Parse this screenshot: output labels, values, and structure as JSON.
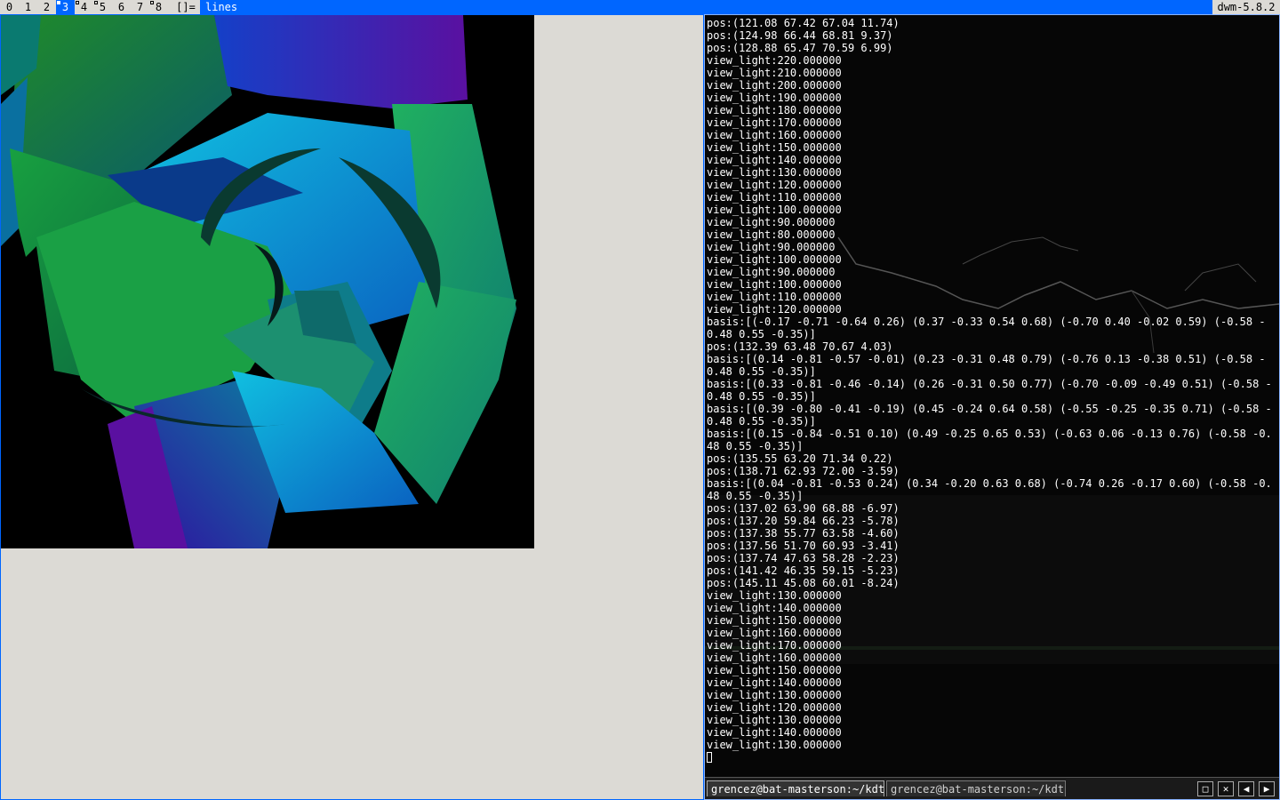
{
  "bar": {
    "tags": [
      {
        "label": "0",
        "selected": false,
        "occupied": false
      },
      {
        "label": "1",
        "selected": false,
        "occupied": false
      },
      {
        "label": "2",
        "selected": false,
        "occupied": false
      },
      {
        "label": "3",
        "selected": true,
        "occupied": true
      },
      {
        "label": "4",
        "selected": false,
        "occupied": true
      },
      {
        "label": "5",
        "selected": false,
        "occupied": true
      },
      {
        "label": "6",
        "selected": false,
        "occupied": false
      },
      {
        "label": "7",
        "selected": false,
        "occupied": false
      },
      {
        "label": "8",
        "selected": false,
        "occupied": true
      }
    ],
    "layout_symbol": "[]=",
    "window_title": "lines",
    "status": "dwm-5.8.2",
    "accent_color": "#0066ff"
  },
  "gl_window": {
    "name": "lines"
  },
  "terminal": {
    "lines": [
      "pos:(121.08 67.42 67.04 11.74)",
      "pos:(124.98 66.44 68.81 9.37)",
      "pos:(128.88 65.47 70.59 6.99)",
      "view_light:220.000000",
      "view_light:210.000000",
      "view_light:200.000000",
      "view_light:190.000000",
      "view_light:180.000000",
      "view_light:170.000000",
      "view_light:160.000000",
      "view_light:150.000000",
      "view_light:140.000000",
      "view_light:130.000000",
      "view_light:120.000000",
      "view_light:110.000000",
      "view_light:100.000000",
      "view_light:90.000000",
      "view_light:80.000000",
      "view_light:90.000000",
      "view_light:100.000000",
      "view_light:90.000000",
      "view_light:100.000000",
      "view_light:110.000000",
      "view_light:120.000000",
      "basis:[(-0.17 -0.71 -0.64 0.26) (0.37 -0.33 0.54 0.68) (-0.70 0.40 -0.02 0.59) (-0.58 -0.48 0.55 -0.35)]",
      "pos:(132.39 63.48 70.67 4.03)",
      "basis:[(0.14 -0.81 -0.57 -0.01) (0.23 -0.31 0.48 0.79) (-0.76 0.13 -0.38 0.51) (-0.58 -0.48 0.55 -0.35)]",
      "basis:[(0.33 -0.81 -0.46 -0.14) (0.26 -0.31 0.50 0.77) (-0.70 -0.09 -0.49 0.51) (-0.58 -0.48 0.55 -0.35)]",
      "basis:[(0.39 -0.80 -0.41 -0.19) (0.45 -0.24 0.64 0.58) (-0.55 -0.25 -0.35 0.71) (-0.58 -0.48 0.55 -0.35)]",
      "basis:[(0.15 -0.84 -0.51 0.10) (0.49 -0.25 0.65 0.53) (-0.63 0.06 -0.13 0.76) (-0.58 -0.48 0.55 -0.35)]",
      "pos:(135.55 63.20 71.34 0.22)",
      "pos:(138.71 62.93 72.00 -3.59)",
      "basis:[(0.04 -0.81 -0.53 0.24) (0.34 -0.20 0.63 0.68) (-0.74 0.26 -0.17 0.60) (-0.58 -0.48 0.55 -0.35)]",
      "pos:(137.02 63.90 68.88 -6.97)",
      "pos:(137.20 59.84 66.23 -5.78)",
      "pos:(137.38 55.77 63.58 -4.60)",
      "pos:(137.56 51.70 60.93 -3.41)",
      "pos:(137.74 47.63 58.28 -2.23)",
      "pos:(141.42 46.35 59.15 -5.23)",
      "pos:(145.11 45.08 60.01 -8.24)",
      "view_light:130.000000",
      "view_light:140.000000",
      "view_light:150.000000",
      "view_light:160.000000",
      "view_light:170.000000",
      "view_light:160.000000",
      "view_light:150.000000",
      "view_light:140.000000",
      "view_light:130.000000",
      "view_light:120.000000",
      "view_light:130.000000",
      "view_light:140.000000",
      "view_light:130.000000"
    ],
    "tabs": [
      {
        "label": "grencez@bat-masterson:~/kdt",
        "active": true
      },
      {
        "label": "grencez@bat-masterson:~/kdt",
        "active": false
      }
    ],
    "buttons": [
      {
        "name": "new-tab-icon",
        "glyph": "□"
      },
      {
        "name": "close-tab-icon",
        "glyph": "✕"
      },
      {
        "name": "prev-tab-icon",
        "glyph": "◀"
      },
      {
        "name": "next-tab-icon",
        "glyph": "▶"
      }
    ]
  }
}
